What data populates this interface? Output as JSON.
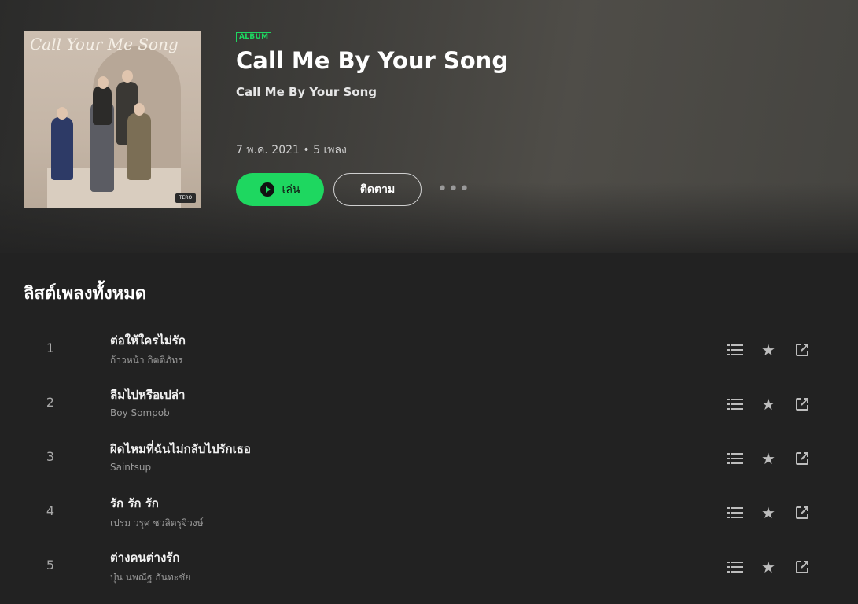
{
  "album": {
    "badge": "ALBUM",
    "title": "Call Me By Your Song",
    "artist": "Call Me By Your Song",
    "meta": "7 พ.ค. 2021 • 5 เพลง",
    "cover_script": "Call Your Me Song",
    "cover_logo": "TERO"
  },
  "actions": {
    "play_label": "เล่น",
    "follow_label": "ติดตาม",
    "more_label": "•••"
  },
  "tracklist": {
    "title": "ลิสต์เพลงทั้งหมด",
    "tracks": [
      {
        "num": "1",
        "title": "ต่อให้ใครไม่รัก",
        "artist": "ก้าวหน้า กิตติภัทร"
      },
      {
        "num": "2",
        "title": "ลืมไปหรือเปล่า",
        "artist": "Boy Sompob"
      },
      {
        "num": "3",
        "title": "ผิดไหมที่ฉันไม่กลับไปรักเธอ",
        "artist": "Saintsup"
      },
      {
        "num": "4",
        "title": "รัก รัก รัก",
        "artist": "เปรม วรุศ ชวลิตรุจิวงษ์"
      },
      {
        "num": "5",
        "title": "ต่างคนต่างรัก",
        "artist": "บุ๋น นพณัฐ กันทะชัย"
      }
    ]
  },
  "icons": {
    "queue": "queue-icon",
    "star": "star-icon",
    "share": "external-link-icon"
  },
  "colors": {
    "accent": "#1ed760",
    "background": "#222222"
  }
}
